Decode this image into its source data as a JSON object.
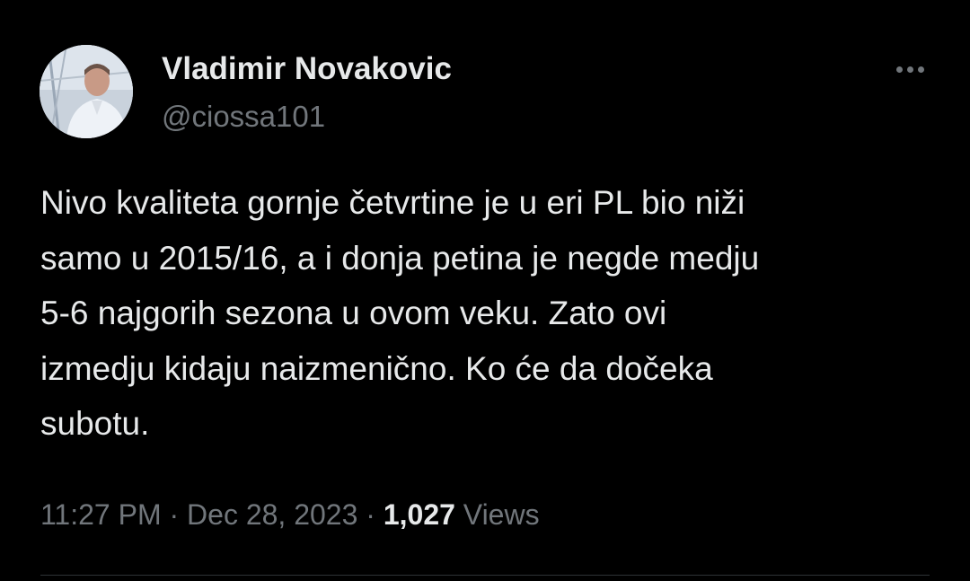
{
  "author": {
    "display_name": "Vladimir Novakovic",
    "handle": "@ciossa101"
  },
  "tweet": {
    "text": "Nivo kvaliteta gornje četvrtine je u eri PL bio niži\nsamo u 2015/16, a i donja petina je negde medju\n5-6 najgorih sezona u ovom veku. Zato ovi\nizmedju kidaju naizmenično. Ko će da dočeka\nsubotu.",
    "time": "11:27 PM",
    "separator": "·",
    "date": "Dec 28, 2023",
    "views_count": "1,027",
    "views_label": "Views"
  },
  "icons": {
    "more": "more-horizontal-icon",
    "avatar": "profile-photo"
  },
  "colors": {
    "background": "#000000",
    "primary_text": "#e7e9ea",
    "secondary_text": "#71767b",
    "divider": "#2f3336"
  }
}
